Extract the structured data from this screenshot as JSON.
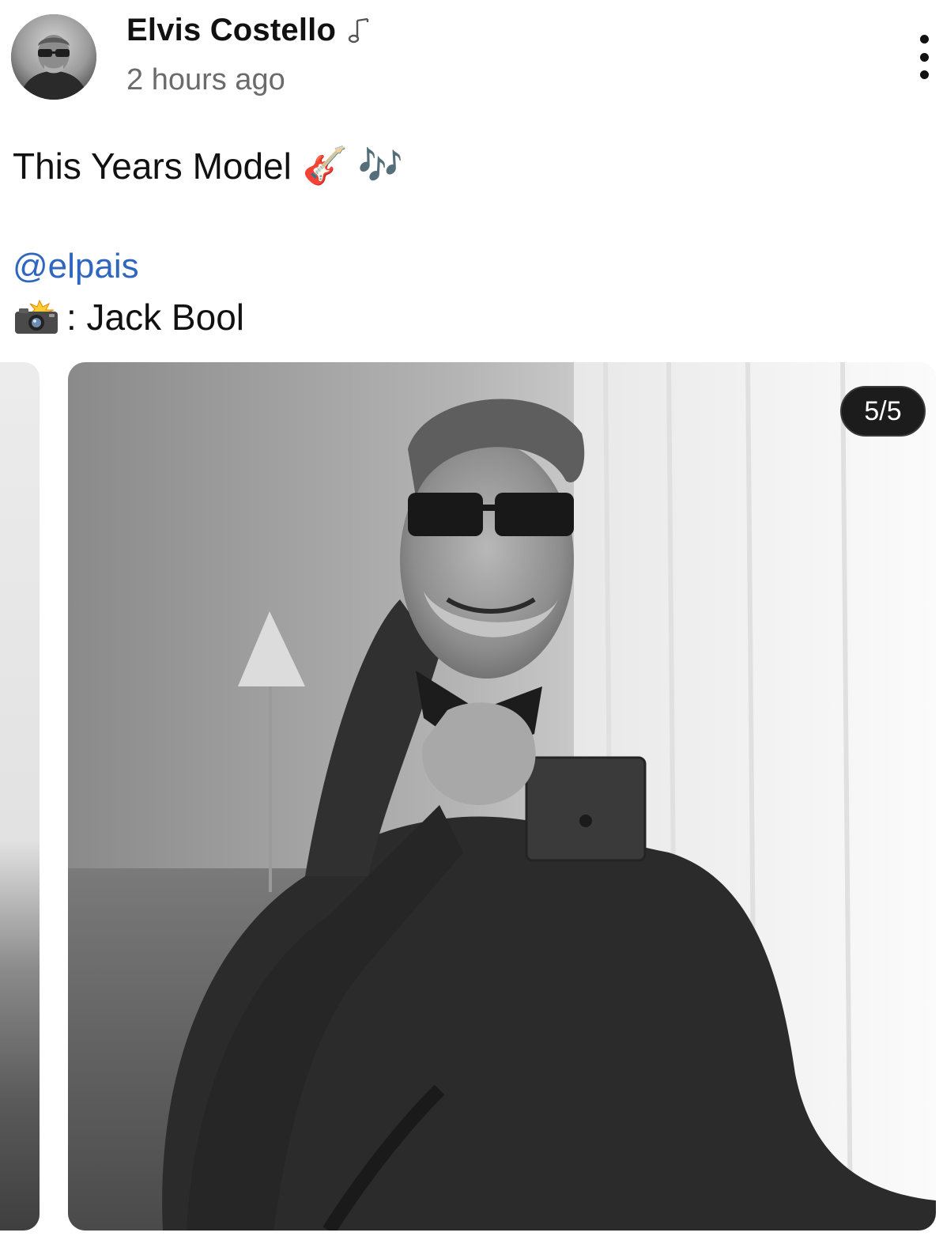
{
  "post": {
    "author": "Elvis Costello",
    "author_badge_icon": "music-note-icon",
    "timestamp": "2 hours ago",
    "caption_text": "This Years Model",
    "caption_emojis": "🎸 🎶",
    "mention": "@elpais",
    "credit_icon": "camera-with-flash-icon",
    "credit_text": ": Jack Bool",
    "more_icon": "vertical-ellipsis-icon"
  },
  "carousel": {
    "counter": "5/5",
    "current_index": 5,
    "total": 5
  },
  "colors": {
    "link": "#2f66c0",
    "timestamp": "#6b6b6b",
    "badge_bg": "#1c1c1c"
  }
}
